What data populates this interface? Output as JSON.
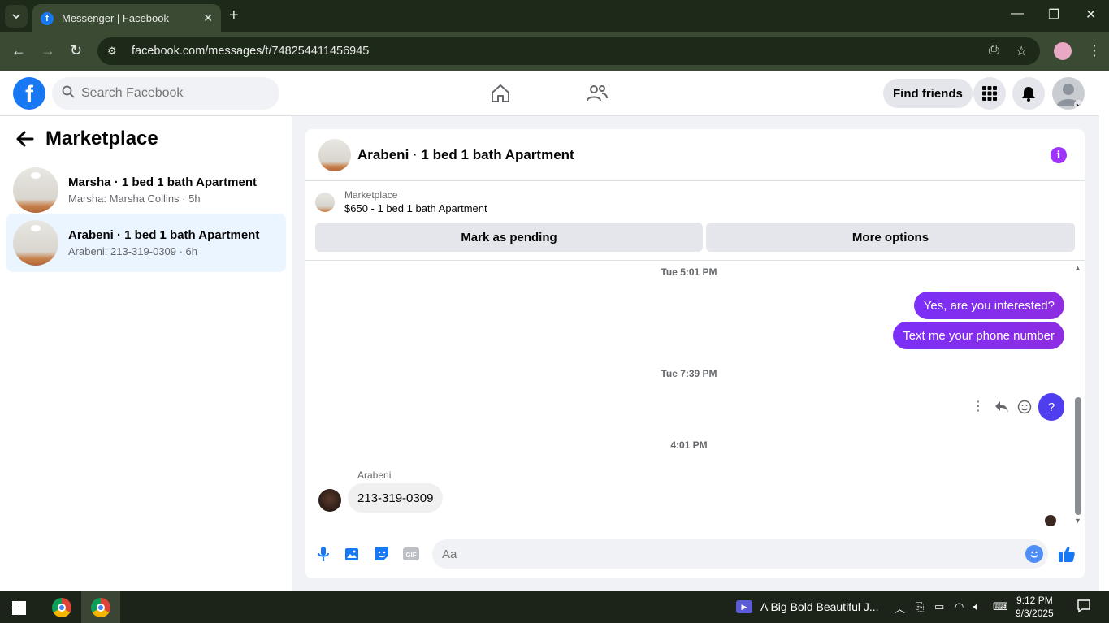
{
  "browser": {
    "tab_title": "Messenger | Facebook",
    "url": "facebook.com/messages/t/748254411456945"
  },
  "fb": {
    "search_placeholder": "Search Facebook",
    "find_friends": "Find friends"
  },
  "sidebar": {
    "title": "Marketplace",
    "conversations": [
      {
        "name": "Marsha · 1 bed 1 bath Apartment",
        "sub": "Marsha: Marsha Collins · 5h",
        "active": false
      },
      {
        "name": "Arabeni · 1 bed 1 bath Apartment",
        "sub": "Arabeni: 213-319-0309 · 6h",
        "active": true
      }
    ]
  },
  "chat": {
    "title": "Arabeni · 1 bed 1 bath Apartment",
    "marketplace_label": "Marketplace",
    "listing": "$650 - 1 bed 1 bath Apartment",
    "mark_pending": "Mark as pending",
    "more_options": "More options",
    "timestamps": [
      "Tue 5:01 PM",
      "Tue 7:39 PM",
      "4:01 PM"
    ],
    "outgoing": [
      "Yes, are you interested?",
      "Text me your phone number"
    ],
    "question_bubble": "?",
    "sender_name": "Arabeni",
    "incoming": "213-319-0309",
    "composer_placeholder": "Aa"
  },
  "taskbar": {
    "media_title": "A Big Bold Beautiful J...",
    "time": "9:12 PM",
    "date": "9/3/2025"
  },
  "colors": {
    "fb_blue": "#1877f2",
    "messenger_purple": "#8a2be2",
    "chrome_dark": "#1e2a19"
  }
}
